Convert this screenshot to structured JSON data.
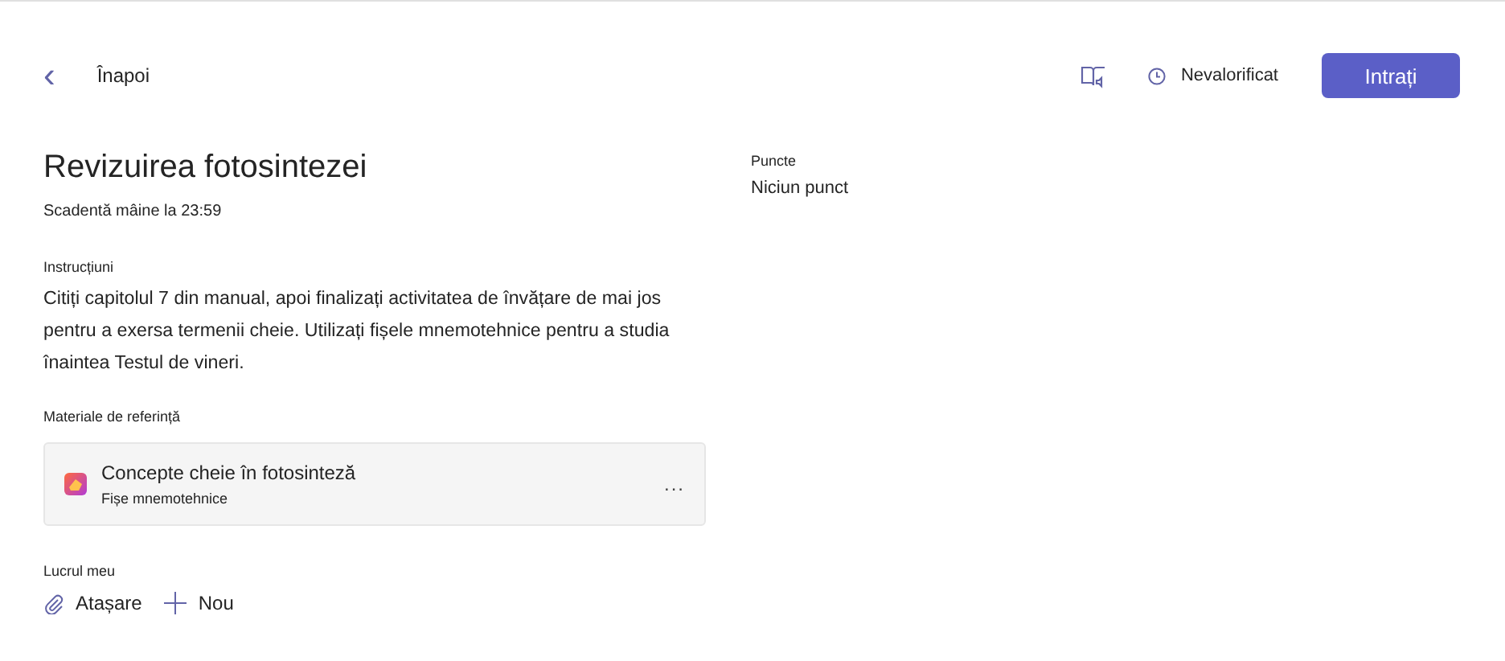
{
  "header": {
    "back": {
      "icon": "‹",
      "label": "Înapoi"
    },
    "status": "Nevalorificat",
    "primary_button": "Intrați"
  },
  "assignment": {
    "title": "Revizuirea fotosintezei",
    "due": "Scadentă mâine la 23:59",
    "instructions_label": "Instrucțiuni",
    "instructions": "Citiți capitolul 7 din manual, apoi finalizați activitatea de învățare de mai jos pentru a exersa termenii cheie. Utilizați fișele mnemotehnice pentru a studia înaintea Testul de vineri.",
    "reference_label": "Materiale de referință",
    "references": [
      {
        "title": "Concepte cheie în fotosinteză",
        "subtitle": "Fișe mnemotehnice",
        "menu": "..."
      }
    ],
    "my_work_label": "Lucrul meu",
    "my_work_actions": [
      {
        "kind": "attach",
        "label": "Atașare"
      },
      {
        "kind": "new",
        "label": "Nou"
      }
    ]
  },
  "points": {
    "label": "Puncte",
    "value": "Niciun punct"
  }
}
